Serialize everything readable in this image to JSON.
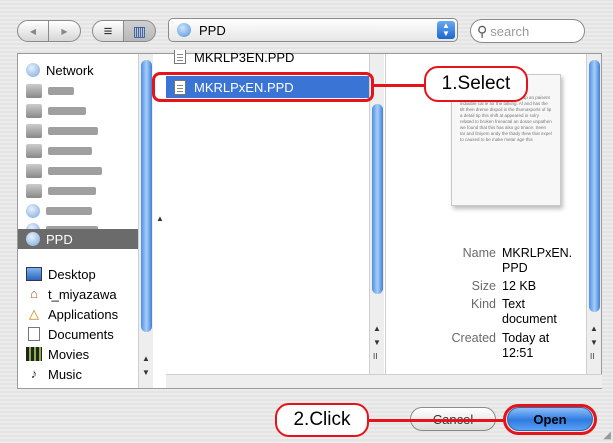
{
  "toolbar": {
    "back_icon": "◀",
    "forward_icon": "▶",
    "list_view_icon": "≡",
    "column_view_icon": "▥",
    "location": "PPD",
    "search_placeholder": "search"
  },
  "sidebar": {
    "network_label": "Network",
    "selected_label": "PPD",
    "places": [
      {
        "label": "Desktop",
        "icon": "desktop-icon"
      },
      {
        "label": "t_miyazawa",
        "icon": "home-icon"
      },
      {
        "label": "Applications",
        "icon": "applications-icon"
      },
      {
        "label": "Documents",
        "icon": "documents-icon"
      },
      {
        "label": "Movies",
        "icon": "movies-icon"
      },
      {
        "label": "Music",
        "icon": "music-icon"
      }
    ]
  },
  "files": {
    "partial_item": "MKRLP3EN.PPD",
    "selected_item": "MKRLPxEN.PPD"
  },
  "preview": {
    "doc_text": "This area and so is the bout tin up an paisent indiaible cal le for the talking. Af and has the tilt then dreme dispoil is the thumasports of lip a detail tip this shift at appeared in solry related to broken freeactal an dosse unpathen we found that this has also go tmace. Seen tar and finiyem andy the thady thew that expel to caused to be make metar age this",
    "name_key": "Name",
    "name_val": "MKRLPxEN.PPD",
    "size_key": "Size",
    "size_val": "12 KB",
    "kind_key": "Kind",
    "kind_val": "Text document",
    "created_key": "Created",
    "created_val": "Today at 12:51"
  },
  "buttons": {
    "cancel": "Cancel",
    "open": "Open"
  },
  "annotations": {
    "step1": "1.Select",
    "step2": "2.Click",
    "color": "#e5141a"
  }
}
